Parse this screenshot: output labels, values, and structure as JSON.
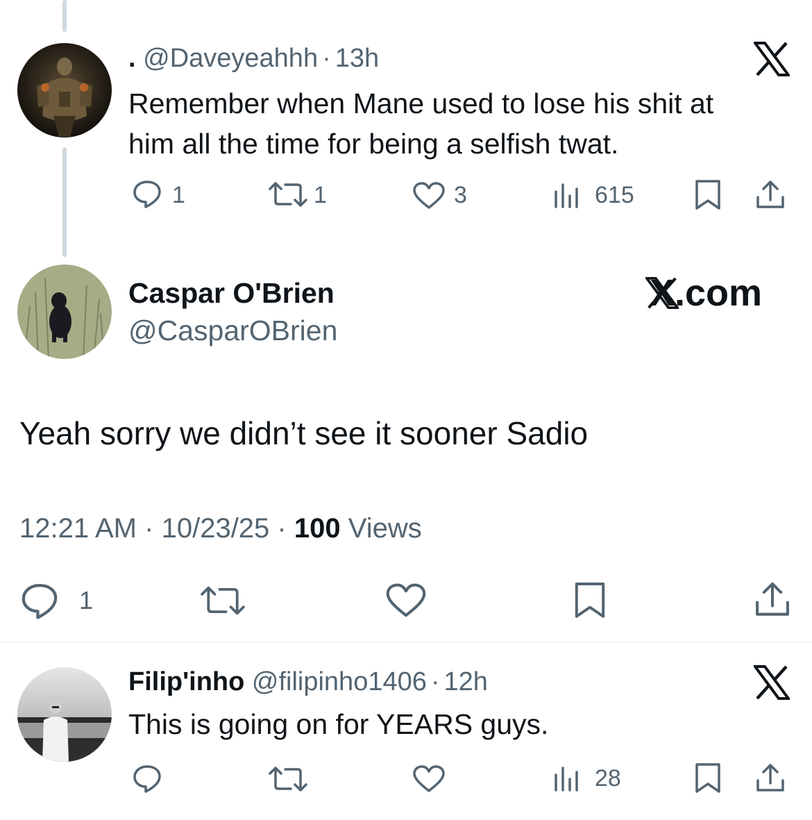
{
  "tweet1": {
    "display_name": ".",
    "handle": "@Daveyeahhh",
    "separator": "·",
    "time": "13h",
    "text_line1": "Remember when Mane used to lose his shit at",
    "text_line2": "him all the time for being a selfish twat.",
    "replies": "1",
    "retweets": "1",
    "likes": "3",
    "views": "615",
    "platform_logo": "x-logo-icon"
  },
  "main_tweet": {
    "display_name": "Caspar O'Brien",
    "handle": "@CasparOBrien",
    "brand": "X.com",
    "text": "Yeah sorry we didn’t see it sooner Sadio",
    "time": "12:21 AM",
    "sep1": "·",
    "date": "10/23/25",
    "sep2": "·",
    "views_count": "100",
    "views_label": "Views",
    "replies": "1"
  },
  "tweet3": {
    "display_name": "Filip'inho",
    "handle": "@filipinho1406",
    "separator": "·",
    "time": "12h",
    "text": "This is going on for YEARS guys.",
    "views": "28",
    "platform_logo": "x-logo-icon"
  },
  "colors": {
    "text": "#0f1419",
    "secondary": "#536471",
    "thread_line": "#cfd9de",
    "divider": "#eff3f4"
  }
}
